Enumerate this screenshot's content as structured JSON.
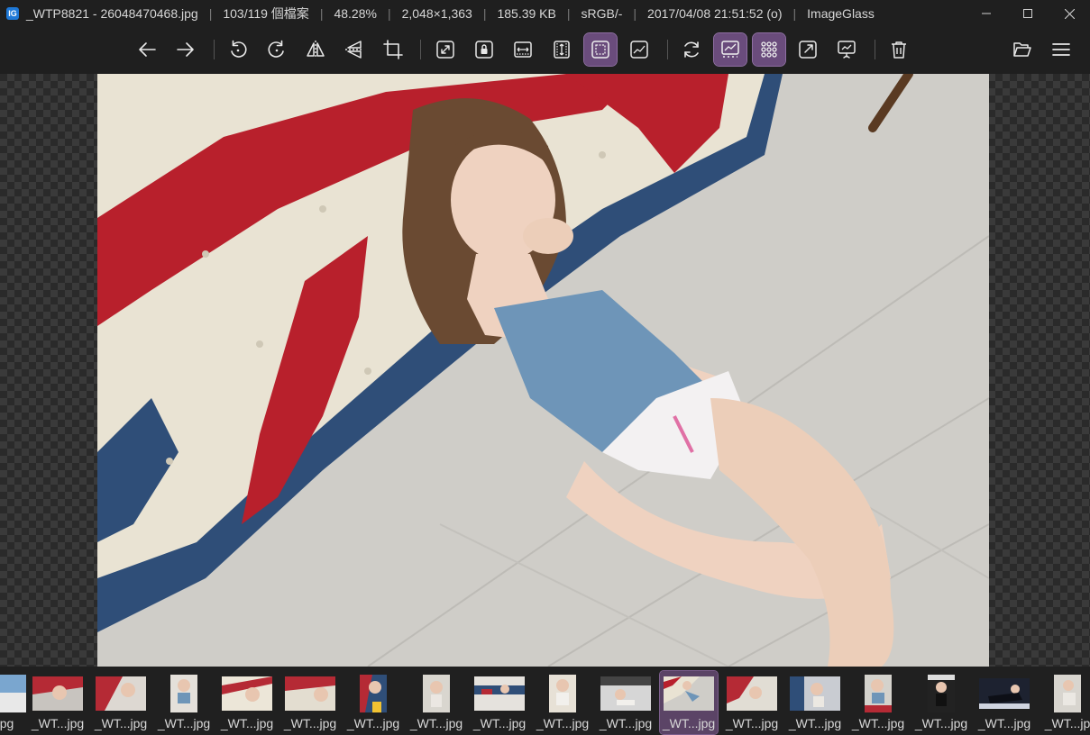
{
  "titlebar": {
    "app_icon_text": "IG",
    "filename": "_WTP8821 - 26048470468.jpg",
    "index": "103/119 個檔案",
    "zoom": "48.28%",
    "dimensions": "2,048×1,363",
    "filesize": "185.39 KB",
    "colorspace": "sRGB/-",
    "datetime": "2017/04/08 21:51:52 (o)",
    "app_name": "ImageGlass"
  },
  "toolbar": {
    "buttons": [
      {
        "icon": "arrow-left-icon"
      },
      {
        "icon": "arrow-right-icon"
      },
      {
        "icon": "rotate-left-icon"
      },
      {
        "icon": "rotate-right-icon"
      },
      {
        "icon": "flip-horizontal-icon"
      },
      {
        "icon": "flip-vertical-icon"
      },
      {
        "icon": "crop-icon"
      },
      {
        "icon": "auto-zoom-icon"
      },
      {
        "icon": "lock-zoom-icon"
      },
      {
        "icon": "scale-to-width-icon"
      },
      {
        "icon": "scale-to-height-icon"
      },
      {
        "icon": "scale-to-fit-icon",
        "active": true
      },
      {
        "icon": "scale-to-fill-icon"
      },
      {
        "icon": "refresh-icon"
      },
      {
        "icon": "gallery-icon",
        "active": true
      },
      {
        "icon": "thumbnail-grid-icon",
        "active": true
      },
      {
        "icon": "fullscreen-icon"
      },
      {
        "icon": "slideshow-icon"
      },
      {
        "icon": "delete-icon"
      },
      {
        "icon": "open-folder-icon"
      },
      {
        "icon": "menu-icon"
      }
    ]
  },
  "colors": {
    "active_button": "#6a4c7c",
    "background": "#1f1f1f",
    "selected_thumb": "#5b4466"
  },
  "thumbnails": [
    {
      "label": ".jpg"
    },
    {
      "label": "_WT...jpg"
    },
    {
      "label": "_WT...jpg"
    },
    {
      "label": "_WT...jpg"
    },
    {
      "label": "_WT...jpg"
    },
    {
      "label": "_WT...jpg"
    },
    {
      "label": "_WT...jpg"
    },
    {
      "label": "_WT...jpg"
    },
    {
      "label": "_WT...jpg"
    },
    {
      "label": "_WT...jpg"
    },
    {
      "label": "_WT...jpg"
    },
    {
      "label": "_WT...jpg",
      "selected": true
    },
    {
      "label": "_WT...jpg"
    },
    {
      "label": "_WT...jpg"
    },
    {
      "label": "_WT...jpg"
    },
    {
      "label": "_WT...jpg"
    },
    {
      "label": "_WT...jpg"
    },
    {
      "label": "_WT...jp"
    }
  ]
}
